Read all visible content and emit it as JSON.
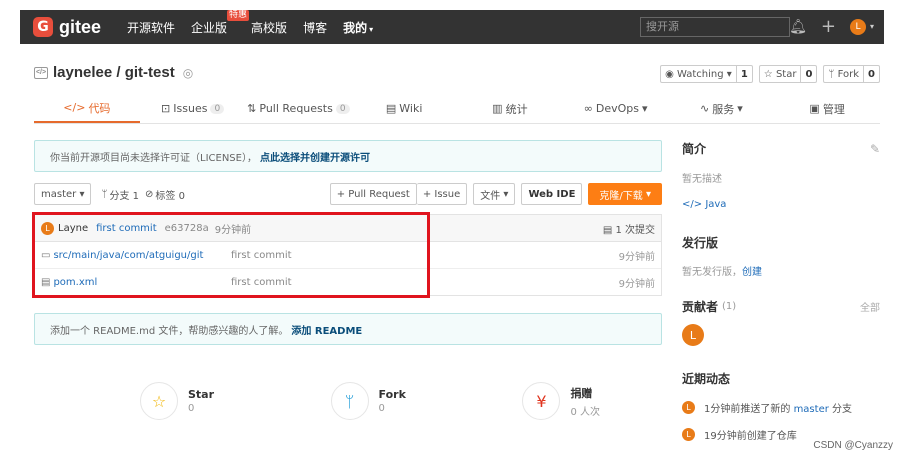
{
  "nav": {
    "logo_mark": "G",
    "logo_text": "gitee",
    "items": [
      "开源软件",
      "企业版",
      "高校版",
      "博客",
      "我的"
    ],
    "hot_badge": "特惠",
    "search_placeholder": "搜开源",
    "avatar_letter": "L"
  },
  "repo": {
    "title": "laynelee / git-test",
    "watching_label": "Watching",
    "watching_count": "1",
    "star_label": "Star",
    "star_count": "0",
    "fork_label": "Fork",
    "fork_count": "0"
  },
  "tabs": [
    {
      "label": "代码",
      "count": ""
    },
    {
      "label": "Issues",
      "count": "0"
    },
    {
      "label": "Pull Requests",
      "count": "0"
    },
    {
      "label": "Wiki",
      "count": ""
    },
    {
      "label": "统计",
      "count": ""
    },
    {
      "label": "DevOps",
      "count": ""
    },
    {
      "label": "服务",
      "count": ""
    },
    {
      "label": "管理",
      "count": ""
    }
  ],
  "license_notice": {
    "text": "你当前开源项目尚未选择许可证（LICENSE），",
    "link": "点此选择并创建开源许可"
  },
  "toolbar": {
    "branch": "master",
    "branches": "分支 1",
    "tags": "标签 0",
    "pull_request": "+ Pull Request",
    "issue": "+ Issue",
    "file": "文件",
    "web_ide": "Web IDE",
    "clone": "克隆/下载"
  },
  "commit": {
    "avatar": "L",
    "author": "Layne",
    "message": "first commit",
    "hash": "e63728a",
    "time": "9分钟前",
    "count": "1 次提交"
  },
  "files": [
    {
      "name": "src/main/java/com/atguigu/git",
      "message": "first commit",
      "time": "9分钟前"
    },
    {
      "name": "pom.xml",
      "message": "first commit",
      "time": "9分钟前"
    }
  ],
  "readme_notice": {
    "text": "添加一个 README.md 文件，帮助感兴趣的人了解。",
    "link": "添加 README"
  },
  "stats": [
    {
      "name": "Star",
      "value": "0"
    },
    {
      "name": "Fork",
      "value": "0"
    },
    {
      "name": "捐赠",
      "value": "0 人次"
    }
  ],
  "sidebar": {
    "intro_title": "简介",
    "intro_text": "暂无描述",
    "language": "Java",
    "release_title": "发行版",
    "release_text": "暂无发行版，",
    "release_link": "创建",
    "contributors_title": "贡献者",
    "contributors_count": "(1)",
    "contributors_all": "全部",
    "contributor_avatar": "L",
    "activity_title": "近期动态",
    "activity": [
      {
        "avatar": "L",
        "prefix": "1分钟前推送了新的",
        "highlight": "master",
        "suffix": "分支"
      },
      {
        "avatar": "L",
        "prefix": "19分钟前创建了仓库",
        "highlight": "",
        "suffix": ""
      }
    ]
  },
  "watermark": "CSDN @Cyanzzy",
  "colors": {
    "accent": "#fd7e14",
    "link": "#1e6bb8",
    "highlight_box": "#e0141e",
    "nav_bg": "#333333"
  }
}
